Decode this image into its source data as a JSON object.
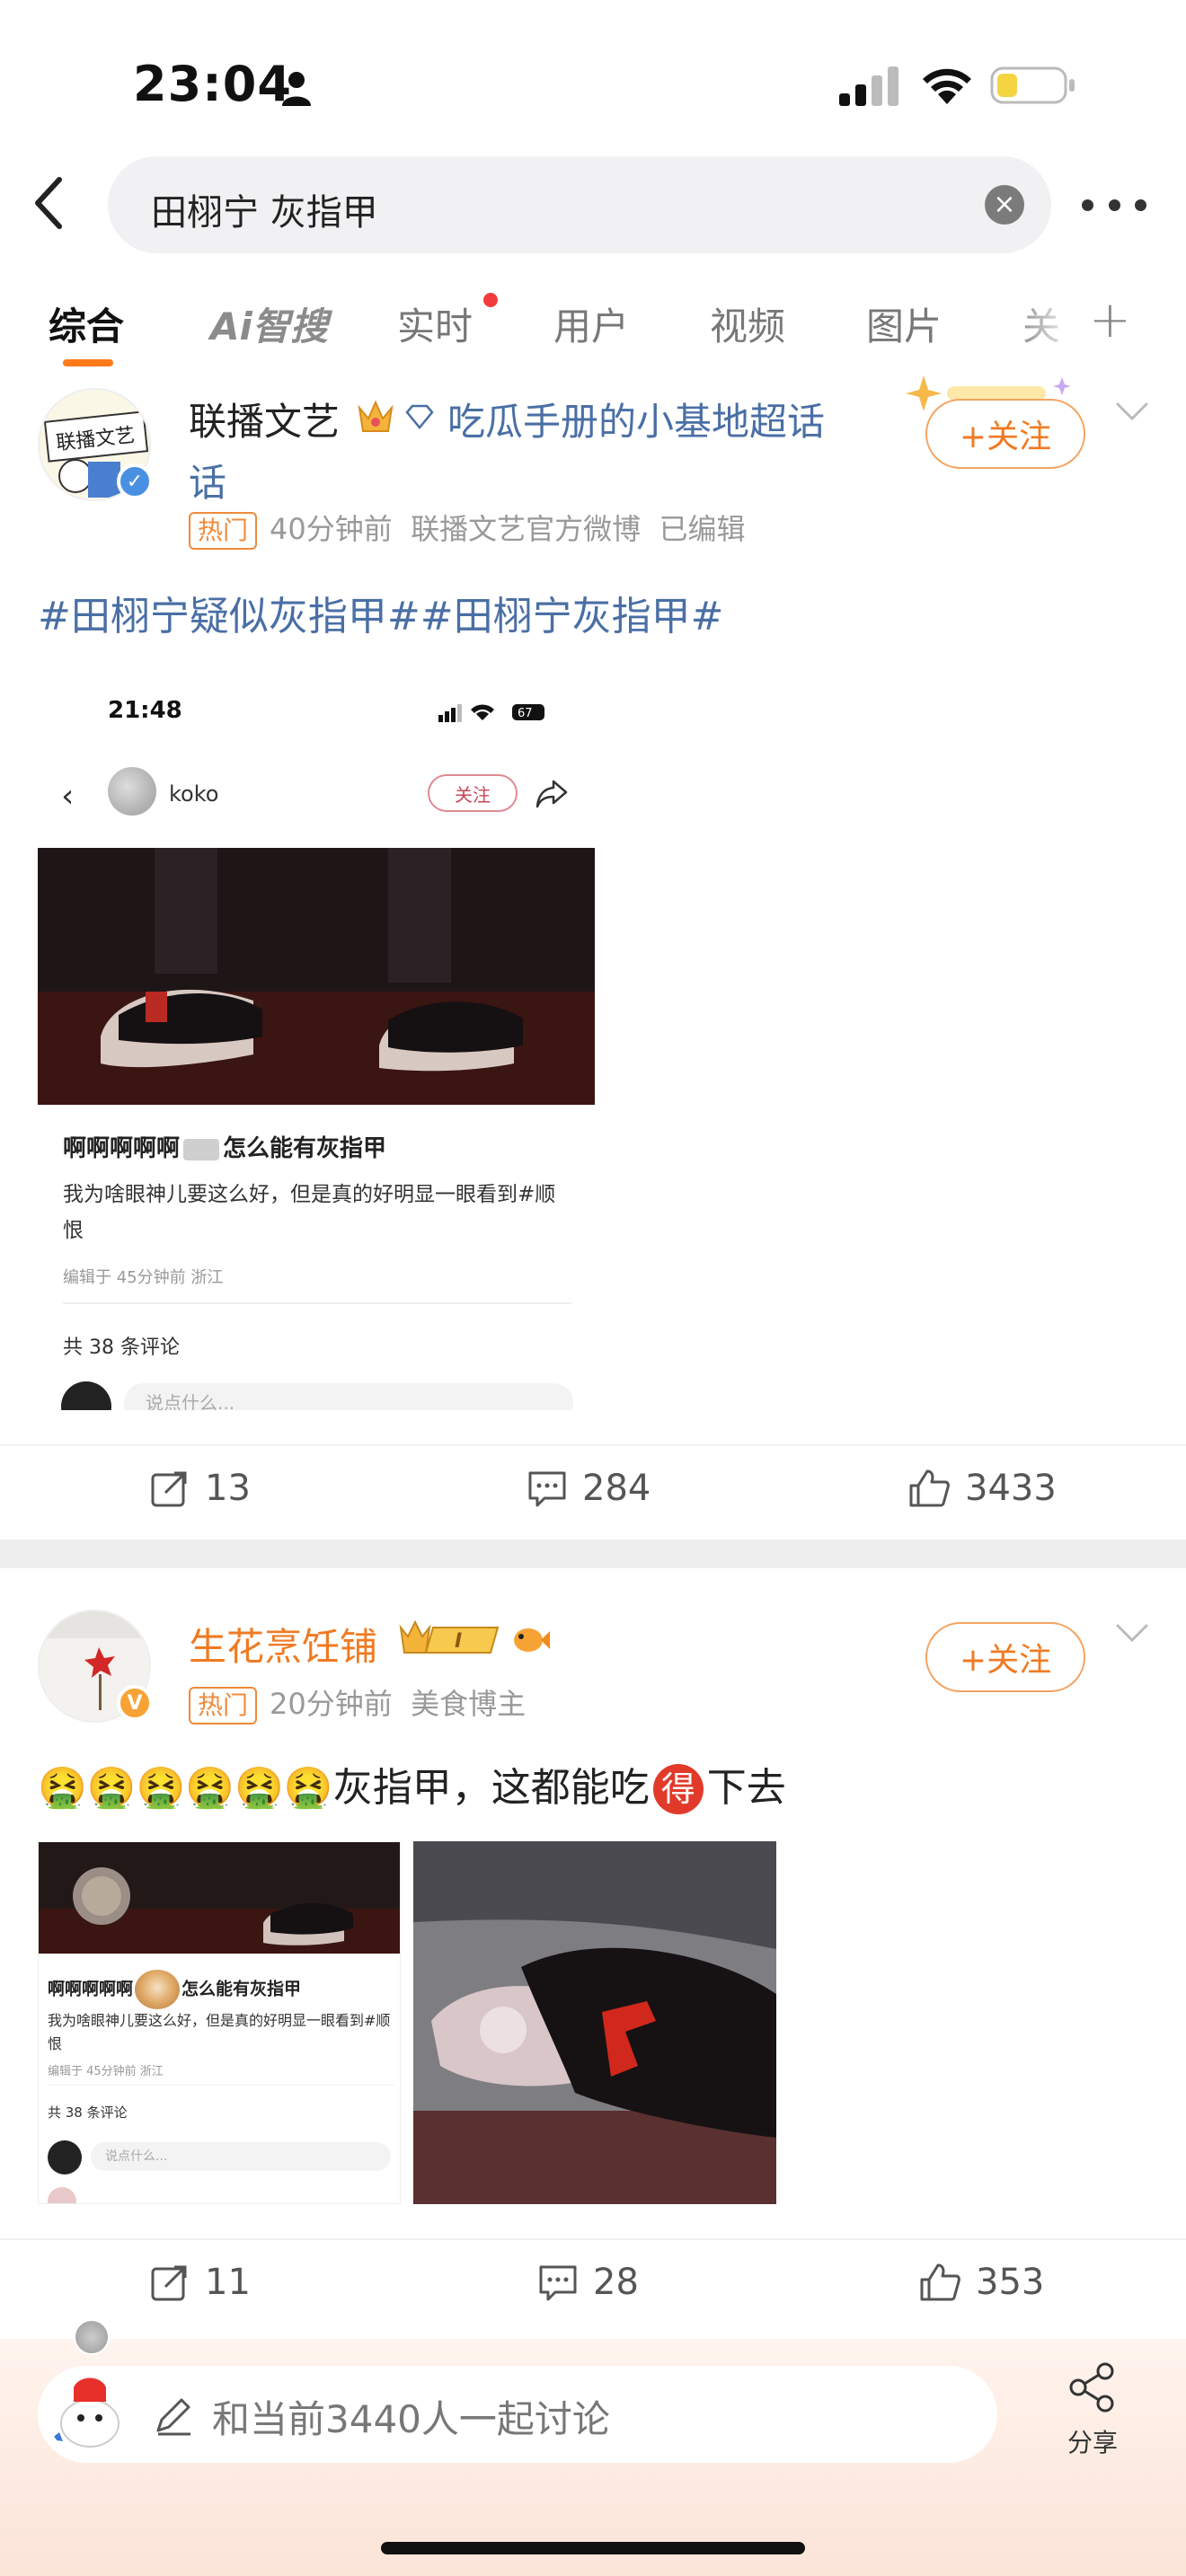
{
  "status_bar": {
    "time": "23:04"
  },
  "search": {
    "query": "田栩宁 灰指甲"
  },
  "tabs": [
    {
      "label": "综合",
      "active": true
    },
    {
      "label": "智搜",
      "prefix": "Ai"
    },
    {
      "label": "实时",
      "has_dot": true
    },
    {
      "label": "用户"
    },
    {
      "label": "视频"
    },
    {
      "label": "图片"
    },
    {
      "label": "关"
    }
  ],
  "posts": [
    {
      "author": "联播文艺",
      "super_topic": "吃瓜手册的小基地超话",
      "super_topic_wrap": "话",
      "hot_badge": "热门",
      "time": "40分钟前",
      "source": "联播文艺官方微博",
      "edited": "已编辑",
      "follow_label": "+关注",
      "text": "#田栩宁疑似灰指甲##田栩宁灰指甲#",
      "embedded": {
        "time": "21:48",
        "battery": "67",
        "username": "koko",
        "follow_label": "关注",
        "title": "啊啊啊啊啊",
        "title_suffix": "怎么能有灰指甲",
        "body": "我为啥眼神儿要这么好，但是真的好明显一眼看到#顺恨",
        "edit_info": "编辑于 45分钟前 浙江",
        "comments": "共 38 条评论",
        "input_placeholder": "说点什么..."
      },
      "reposts": "13",
      "comments": "284",
      "likes": "3433"
    },
    {
      "author": "生花烹饪铺",
      "vip_label": "I",
      "hot_badge": "热门",
      "time": "20分钟前",
      "source": "美食博主",
      "follow_label": "+关注",
      "text_prefix": "🤮🤮🤮🤮🤮🤮",
      "text_main": "灰指甲，这都能吃",
      "text_special": "得",
      "text_suffix": "下去",
      "embedded": {
        "title": "啊啊啊啊啊",
        "title_suffix": "怎么能有灰指甲",
        "body": "我为啥眼神儿要这么好，但是真的好明显一眼看到#顺恨",
        "edit_info": "编辑于 45分钟前 浙江",
        "comments": "共 38 条评论",
        "input_placeholder": "说点什么..."
      },
      "reposts": "11",
      "comments": "28",
      "likes": "353"
    }
  ],
  "bottom": {
    "placeholder": "和当前3440人一起讨论",
    "share_label": "分享"
  },
  "colors": {
    "accent": "#f07a22",
    "hashtag": "#4a6fa5",
    "tab_indicator": "#ff7a1a"
  }
}
